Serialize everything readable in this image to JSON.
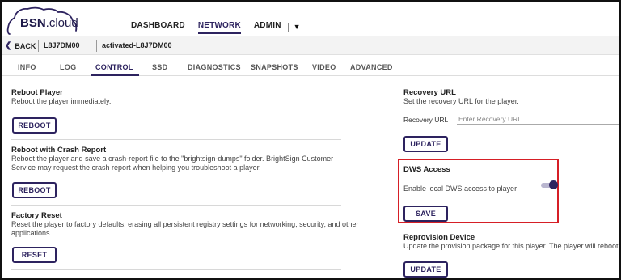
{
  "brand": {
    "logo_bold": "BSN",
    "logo_light": ".cloud"
  },
  "nav": {
    "dashboard": "DASHBOARD",
    "network": "NETWORK",
    "admin": "ADMIN",
    "dropdown_caret": "▼"
  },
  "breadcrumb": {
    "back": "BACK",
    "device_id": "L8J7DM00",
    "device_name": "activated-L8J7DM00"
  },
  "tabs": [
    "INFO",
    "LOG",
    "CONTROL",
    "SSD",
    "DIAGNOSTICS",
    "SNAPSHOTS",
    "VIDEO",
    "ADVANCED"
  ],
  "active_tab": "CONTROL",
  "left": {
    "reboot": {
      "title": "Reboot Player",
      "desc": "Reboot the player immediately.",
      "button": "REBOOT"
    },
    "crash": {
      "title": "Reboot with Crash Report",
      "desc1": "Reboot the player and save a crash-report file to the \"brightsign-dumps\" folder. BrightSign Customer",
      "desc2": "Service may request the crash report when helping you troubleshoot a player.",
      "button": "REBOOT"
    },
    "factory": {
      "title": "Factory Reset",
      "desc1": "Reset the player to factory defaults, erasing all persistent registry settings for networking, security, and other",
      "desc2": "applications.",
      "button": "RESET"
    }
  },
  "right": {
    "recovery": {
      "title": "Recovery URL",
      "desc": "Set the recovery URL for the player.",
      "field_label": "Recovery URL",
      "placeholder": "Enter Recovery URL",
      "button": "UPDATE"
    },
    "dws": {
      "title": "DWS Access",
      "desc": "Enable local DWS access to player",
      "toggle_on": true,
      "button": "SAVE"
    },
    "reprovision": {
      "title": "Reprovision Device",
      "desc": "Update the provision package for this player. The player will reboot",
      "button": "UPDATE"
    }
  },
  "colors": {
    "accent": "#2d235f",
    "highlight": "#d61f26"
  }
}
